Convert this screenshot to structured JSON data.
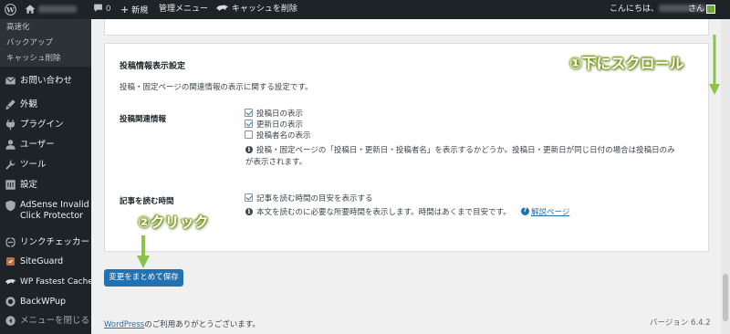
{
  "adminbar": {
    "comment_count": "0",
    "new_label": "新規",
    "admin_menu": "管理メニュー",
    "cache_clear": "キャッシュを削除",
    "greeting": "こんにちは、",
    "san": "さん"
  },
  "sidebar": {
    "submenu": [
      "高速化",
      "バックアップ",
      "キャッシュ削除"
    ],
    "items": [
      {
        "label": "お問い合わせ",
        "icon": "mail-icon"
      },
      {
        "label": "外観",
        "icon": "brush-icon"
      },
      {
        "label": "プラグイン",
        "icon": "plugin-icon"
      },
      {
        "label": "ユーザー",
        "icon": "user-icon"
      },
      {
        "label": "ツール",
        "icon": "wrench-icon"
      },
      {
        "label": "設定",
        "icon": "settings-icon"
      },
      {
        "label": "AdSense Invalid Click Protector",
        "icon": "shield-icon"
      },
      {
        "label": "リンクチェッカー",
        "icon": "link-icon"
      },
      {
        "label": "SiteGuard",
        "icon": "siteguard-icon"
      },
      {
        "label": "WP Fastest Cache",
        "icon": "cheetah-icon"
      },
      {
        "label": "BackWPup",
        "icon": "backwpup-icon"
      },
      {
        "label": "メニューを閉じる",
        "icon": "collapse-icon"
      }
    ]
  },
  "section": {
    "title": "投稿情報表示設定",
    "description": "投稿・固定ページの関連情報の表示に関する設定です。",
    "post_info": {
      "label": "投稿関連情報",
      "options": [
        {
          "label": "投稿日の表示",
          "checked": true
        },
        {
          "label": "更新日の表示",
          "checked": true
        },
        {
          "label": "投稿者名の表示",
          "checked": false
        }
      ],
      "help_line1": "投稿・固定ページの「投稿日・更新日・投稿者名」を表示するかどうか。投稿日・更新日が同じ日付の場合は投稿日のみ",
      "help_line2": "が表示されます。"
    },
    "reading_time": {
      "label": "記事を読む時間",
      "option": {
        "label": "記事を読む時間の目安を表示する",
        "checked": true
      },
      "help": "本文を読むのに必要な所要時間を表示します。時間はあくまで目安です。",
      "help_link": "解説ページ"
    }
  },
  "save_button": "変更をまとめて保存",
  "footer": {
    "wp_link": "WordPress",
    "thanks": "のご利用ありがとうございます。",
    "version": "バージョン 6.4.2"
  },
  "annotations": {
    "scroll": "①下にスクロール",
    "click": "②クリック"
  },
  "colors": {
    "admin_dark": "#1d2327",
    "accent": "#2271b1",
    "annotation_green": "#8bc34a"
  }
}
